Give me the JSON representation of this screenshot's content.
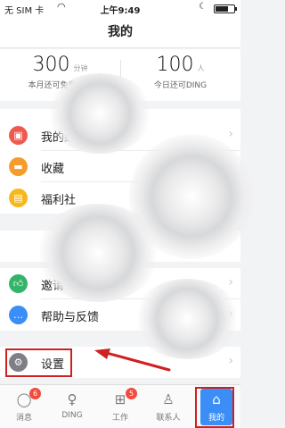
{
  "status_bar": {
    "carrier": "无 SIM 卡",
    "time": "上午9:49",
    "battery_level": 0.7
  },
  "nav": {
    "title": "我的"
  },
  "stats": {
    "left": {
      "value": "300",
      "unit": "分钟",
      "label": "本月还可免费拨打"
    },
    "right": {
      "value": "100",
      "unit": "人",
      "label": "今日还可DING"
    }
  },
  "menu_group_1": [
    {
      "label": "我的红包",
      "icon": "red-envelope-icon",
      "color": "#ef5a4f"
    },
    {
      "label": "收藏",
      "icon": "favorites-icon",
      "color": "#f59c2b"
    },
    {
      "label": "福利社",
      "icon": "welfare-ticket-icon",
      "color": "#f7b71c"
    }
  ],
  "menu_group_2": [
    {
      "label": "邀请",
      "icon": "thumbs-up-icon",
      "color": "#34b46a"
    },
    {
      "label": "帮助与反馈",
      "icon": "chat-bubble-icon",
      "color": "#3a8ef5"
    }
  ],
  "menu_group_3": [
    {
      "label": "设置",
      "icon": "gear-icon",
      "color": "#7f7f86"
    }
  ],
  "tabs": [
    {
      "label": "消息",
      "icon": "message-icon",
      "badge": "6"
    },
    {
      "label": "DING",
      "icon": "ding-icon",
      "badge": ""
    },
    {
      "label": "工作",
      "icon": "work-grid-icon",
      "badge": "5"
    },
    {
      "label": "联系人",
      "icon": "contacts-icon",
      "badge": ""
    },
    {
      "label": "我的",
      "icon": "home-icon",
      "badge": ""
    }
  ],
  "colors": {
    "accent": "#3a8ef5",
    "highlight": "#d01f1f",
    "badge": "#f24b3c"
  }
}
